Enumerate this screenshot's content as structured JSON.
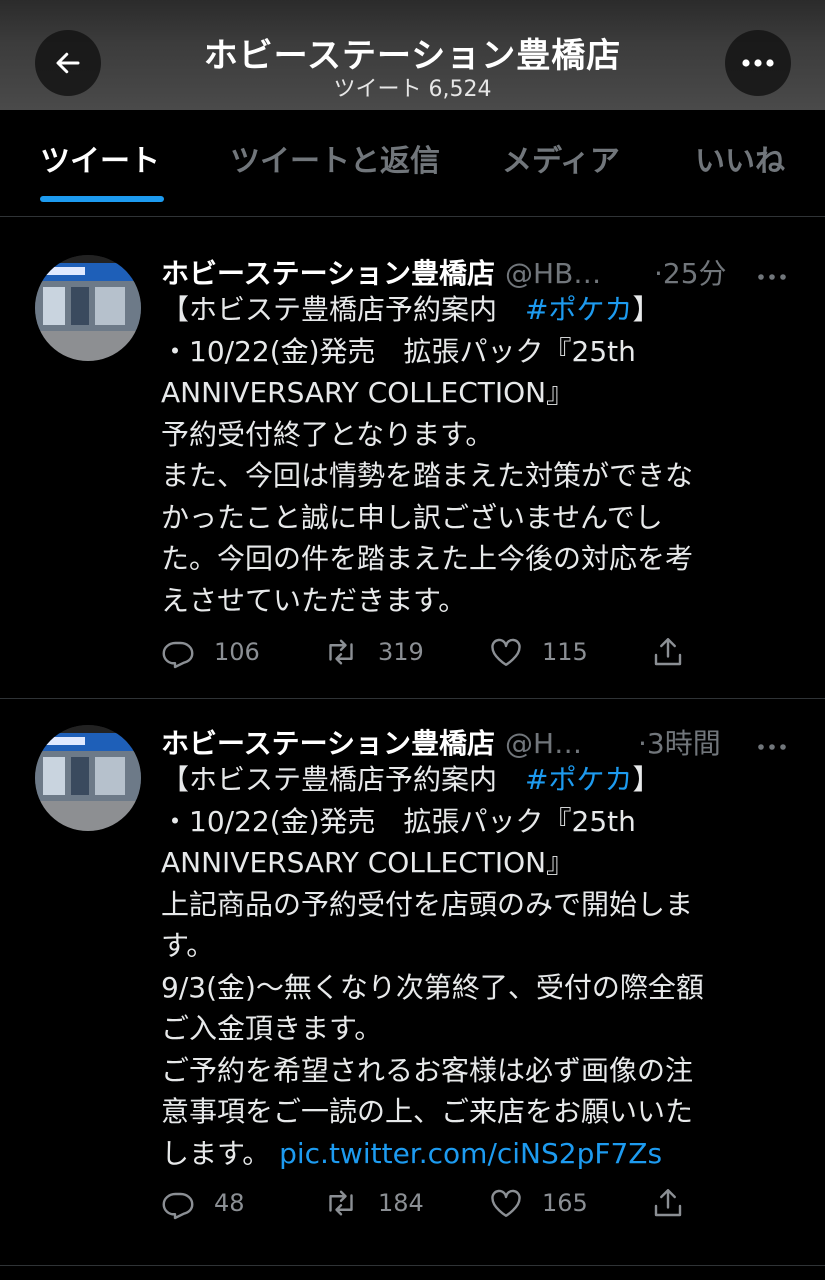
{
  "header": {
    "title": "ホビーステーション豊橋店",
    "subtitle": "ツイート 6,524"
  },
  "tabs": [
    {
      "label": "ツイート",
      "active": true
    },
    {
      "label": "ツイートと返信",
      "active": false
    },
    {
      "label": "メディア",
      "active": false
    },
    {
      "label": "いいね",
      "active": false
    }
  ],
  "colors": {
    "accent": "#1d9bf0",
    "background": "#000000",
    "muted": "#71767b"
  },
  "tweets": [
    {
      "name": "ホビーステーション豊橋店",
      "handle": "@HB…",
      "time": "·25分",
      "lines": [
        {
          "pre": "【ホビステ豊橋店予約案内　",
          "hashtag": "#ポケカ",
          "post": "】"
        },
        {
          "text": "・10/22(金)発売　拡張パック『25th"
        },
        {
          "text": "ANNIVERSARY COLLECTION』"
        },
        {
          "text": "予約受付終了となります。"
        },
        {
          "text": "また、今回は情勢を踏まえた対策ができな"
        },
        {
          "text": "かったこと誠に申し訳ございませんでし"
        },
        {
          "text": "た。今回の件を踏まえた上今後の対応を考"
        },
        {
          "text": "えさせていただきます。"
        }
      ],
      "replies": "106",
      "retweets": "319",
      "likes": "115"
    },
    {
      "name": "ホビーステーション豊橋店",
      "handle": "@H…",
      "time": "·3時間",
      "lines": [
        {
          "pre": "【ホビステ豊橋店予約案内　",
          "hashtag": "#ポケカ",
          "post": "】"
        },
        {
          "text": "・10/22(金)発売　拡張パック『25th"
        },
        {
          "text": "ANNIVERSARY COLLECTION』"
        },
        {
          "text": "上記商品の予約受付を店頭のみで開始しま"
        },
        {
          "text": "す。"
        },
        {
          "text": "9/3(金)〜無くなり次第終了、受付の際全額"
        },
        {
          "text": "ご入金頂きます。"
        },
        {
          "text": "ご予約を希望されるお客様は必ず画像の注"
        },
        {
          "text": "意事項をご一読の上、ご来店をお願いいた"
        },
        {
          "pre": "します。 ",
          "link": "pic.twitter.com/ciNS2pF7Zs"
        }
      ],
      "replies": "48",
      "retweets": "184",
      "likes": "165"
    }
  ]
}
